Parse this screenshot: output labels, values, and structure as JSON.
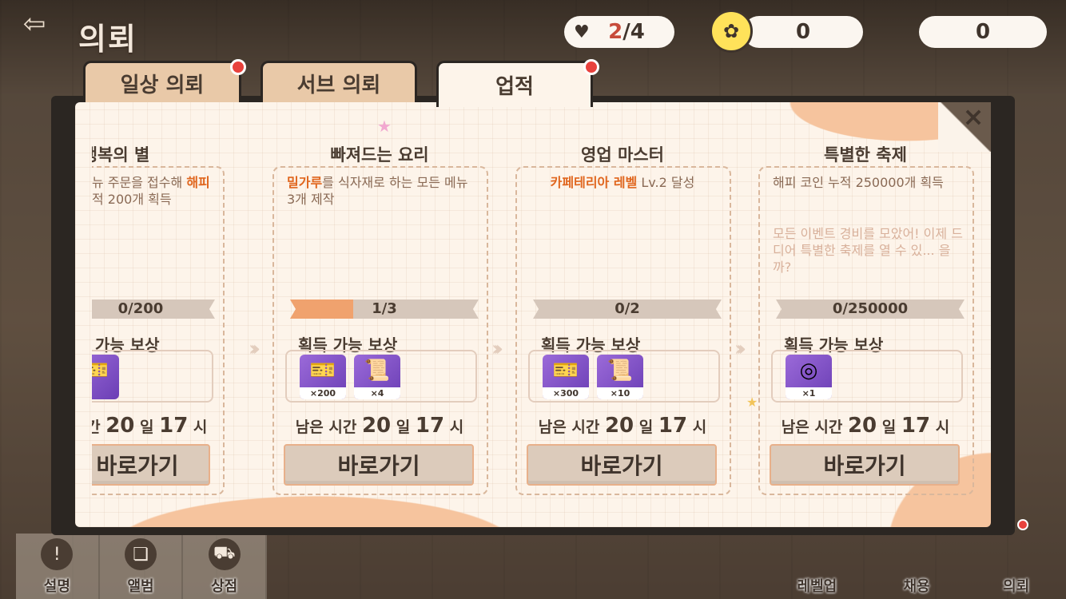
{
  "header": {
    "title": "의뢰",
    "stamina": {
      "current": "2",
      "separator": "/",
      "max": "4"
    },
    "coins": "0",
    "gems": "0"
  },
  "tabs": [
    {
      "label": "일상 의뢰",
      "has_dot": true
    },
    {
      "label": "서브 의뢰",
      "has_dot": false
    },
    {
      "label": "업적",
      "has_dot": true,
      "active": true
    }
  ],
  "cards": [
    {
      "title": "행복의 별",
      "desc_parts": [
        "뉴 주문을 접수해 ",
        "해피",
        "",
        "적 200개 획득"
      ],
      "progress_text": "0/200",
      "progress_fraction": 0,
      "reward_label": "가능 보상",
      "rewards": [
        {
          "icon": "ticket-icon",
          "qty": ""
        }
      ],
      "time_label": "시간",
      "days": "20",
      "day_unit": "일",
      "hours": "17",
      "hour_unit": "시",
      "button": "바로가기"
    },
    {
      "title": "빠져드는 요리",
      "desc_parts": [
        "밀가루",
        "를 식자재로 하는 모든 메뉴 3개 제작"
      ],
      "progress_text": "1/3",
      "progress_fraction": 0.333,
      "reward_label": "획득 가능 보상",
      "rewards": [
        {
          "icon": "ticket-icon",
          "qty": "×200"
        },
        {
          "icon": "recipe-scroll-icon",
          "qty": "×4"
        }
      ],
      "time_label": "남은 시간",
      "days": "20",
      "day_unit": "일",
      "hours": "17",
      "hour_unit": "시",
      "button": "바로가기"
    },
    {
      "title": "영업 마스터",
      "desc_parts": [
        "카페테리아 레벨",
        " Lv.2 달성"
      ],
      "progress_text": "0/2",
      "progress_fraction": 0,
      "reward_label": "획득 가능 보상",
      "rewards": [
        {
          "icon": "ticket-icon",
          "qty": "×300"
        },
        {
          "icon": "recipe-scroll-icon",
          "qty": "×10"
        }
      ],
      "time_label": "남은 시간",
      "days": "20",
      "day_unit": "일",
      "hours": "17",
      "hour_unit": "시",
      "button": "바로가기"
    },
    {
      "title": "특별한 축제",
      "desc": "해피 코인 누적 250000개 획득",
      "flavor": "모든 이벤트 경비를 모았어! 이제 드디어 특별한 축제를 열 수 있... 을까?",
      "progress_text": "0/250000",
      "progress_fraction": 0,
      "reward_label": "획득 가능 보상",
      "rewards": [
        {
          "icon": "ring-frame-icon",
          "qty": "×1"
        }
      ],
      "time_label": "남은 시간",
      "days": "20",
      "day_unit": "일",
      "hours": "17",
      "hour_unit": "시",
      "button": "바로가기"
    }
  ],
  "bottom_nav": [
    "설명",
    "앨범",
    "상점"
  ],
  "right_nav": [
    "레벨업",
    "채용",
    "의뢰"
  ],
  "colors": {
    "highlight": "#e0661e",
    "progress_fill": "#f0a26e",
    "red_dot": "#e8413c",
    "tab_inactive": "#e9c9a8",
    "paper": "#fdf4ea"
  }
}
